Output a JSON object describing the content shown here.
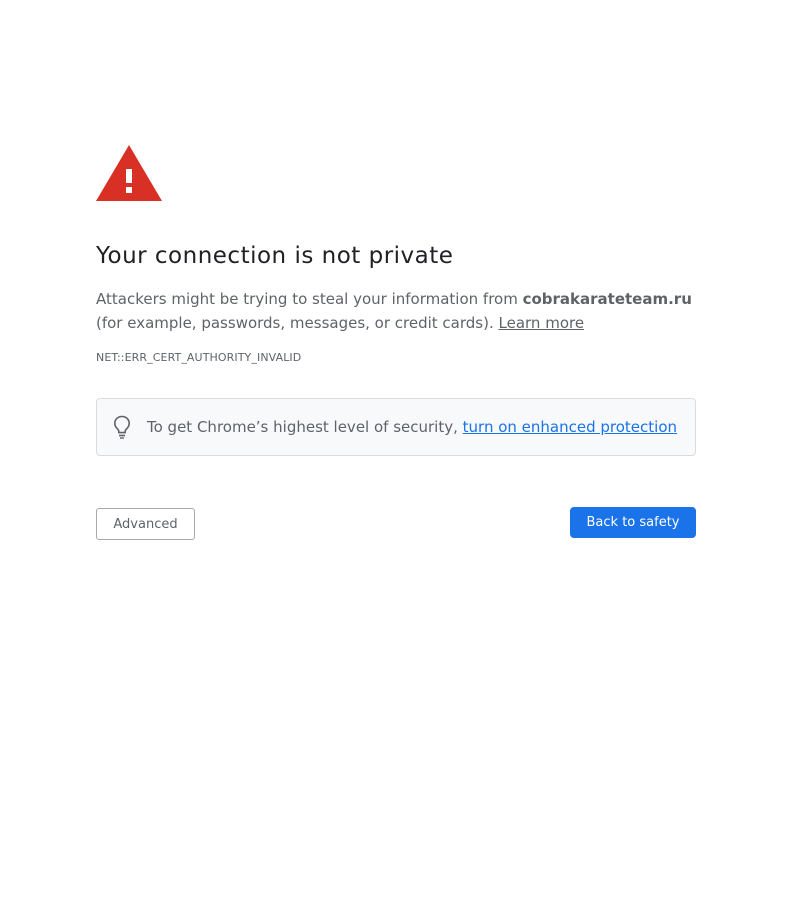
{
  "page": {
    "title": "Your connection is not private",
    "explanation_prefix": "Attackers might be trying to steal your information from ",
    "host": "cobrakarateteam.ru",
    "explanation_suffix": " (for example, passwords, messages, or credit cards). ",
    "learn_more": "Learn more",
    "error_code": "NET::ERR_CERT_AUTHORITY_INVALID"
  },
  "enhanced_protection": {
    "text": "To get Chrome’s highest level of security, ",
    "link": "turn on enhanced protection"
  },
  "buttons": {
    "advanced": "Advanced",
    "back_to_safety": "Back to safety"
  },
  "colors": {
    "warning_red": "#d93025",
    "accent_blue": "#1a73e8",
    "text_secondary": "#5f6368"
  },
  "icons": {
    "warning": "warning-triangle-icon",
    "bulb": "lightbulb-icon"
  }
}
